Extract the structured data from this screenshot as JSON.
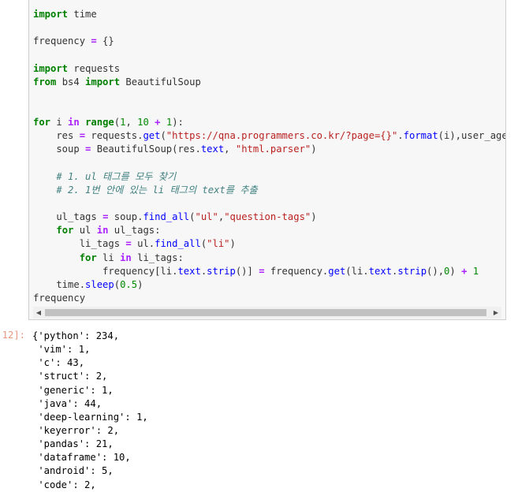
{
  "code_lines": [
    [
      {
        "t": "import",
        "c": "kw"
      },
      {
        "t": " time",
        "c": "plain"
      }
    ],
    [],
    [
      {
        "t": "frequency ",
        "c": "plain"
      },
      {
        "t": "=",
        "c": "op"
      },
      {
        "t": " {}",
        "c": "plain"
      }
    ],
    [],
    [
      {
        "t": "import",
        "c": "kw"
      },
      {
        "t": " requests",
        "c": "plain"
      }
    ],
    [
      {
        "t": "from",
        "c": "kw"
      },
      {
        "t": " bs4 ",
        "c": "plain"
      },
      {
        "t": "import",
        "c": "kw"
      },
      {
        "t": " BeautifulSoup",
        "c": "plain"
      }
    ],
    [],
    [],
    [
      {
        "t": "for",
        "c": "kw"
      },
      {
        "t": " i ",
        "c": "plain"
      },
      {
        "t": "in",
        "c": "op"
      },
      {
        "t": " ",
        "c": "plain"
      },
      {
        "t": "range",
        "c": "kw"
      },
      {
        "t": "(",
        "c": "plain"
      },
      {
        "t": "1",
        "c": "num"
      },
      {
        "t": ", ",
        "c": "plain"
      },
      {
        "t": "10",
        "c": "num"
      },
      {
        "t": " ",
        "c": "plain"
      },
      {
        "t": "+",
        "c": "op"
      },
      {
        "t": " ",
        "c": "plain"
      },
      {
        "t": "1",
        "c": "num"
      },
      {
        "t": "):",
        "c": "plain"
      }
    ],
    [
      {
        "t": "    res ",
        "c": "plain"
      },
      {
        "t": "=",
        "c": "op"
      },
      {
        "t": " requests",
        "c": "plain"
      },
      {
        "t": ".",
        "c": "plain"
      },
      {
        "t": "get",
        "c": "fn"
      },
      {
        "t": "(",
        "c": "plain"
      },
      {
        "t": "\"https://qna.programmers.co.kr/?page={}\"",
        "c": "str"
      },
      {
        "t": ".",
        "c": "plain"
      },
      {
        "t": "format",
        "c": "fn"
      },
      {
        "t": "(i),user_agent",
        "c": "plain"
      }
    ],
    [
      {
        "t": "    soup ",
        "c": "plain"
      },
      {
        "t": "=",
        "c": "op"
      },
      {
        "t": " BeautifulSoup(res",
        "c": "plain"
      },
      {
        "t": ".",
        "c": "plain"
      },
      {
        "t": "text",
        "c": "fn"
      },
      {
        "t": ", ",
        "c": "plain"
      },
      {
        "t": "\"html.parser\"",
        "c": "str"
      },
      {
        "t": ")",
        "c": "plain"
      }
    ],
    [],
    [
      {
        "t": "    # 1. ul 태그를 모두 찾기",
        "c": "cm"
      }
    ],
    [
      {
        "t": "    # 2. 1번 안에 있는 li 태그의 text를 추출",
        "c": "cm"
      }
    ],
    [],
    [
      {
        "t": "    ul_tags ",
        "c": "plain"
      },
      {
        "t": "=",
        "c": "op"
      },
      {
        "t": " soup",
        "c": "plain"
      },
      {
        "t": ".",
        "c": "plain"
      },
      {
        "t": "find_all",
        "c": "fn"
      },
      {
        "t": "(",
        "c": "plain"
      },
      {
        "t": "\"ul\"",
        "c": "str"
      },
      {
        "t": ",",
        "c": "plain"
      },
      {
        "t": "\"question-tags\"",
        "c": "str"
      },
      {
        "t": ")",
        "c": "plain"
      }
    ],
    [
      {
        "t": "    ",
        "c": "plain"
      },
      {
        "t": "for",
        "c": "kw"
      },
      {
        "t": " ul ",
        "c": "plain"
      },
      {
        "t": "in",
        "c": "op"
      },
      {
        "t": " ul_tags:",
        "c": "plain"
      }
    ],
    [
      {
        "t": "        li_tags ",
        "c": "plain"
      },
      {
        "t": "=",
        "c": "op"
      },
      {
        "t": " ul",
        "c": "plain"
      },
      {
        "t": ".",
        "c": "plain"
      },
      {
        "t": "find_all",
        "c": "fn"
      },
      {
        "t": "(",
        "c": "plain"
      },
      {
        "t": "\"li\"",
        "c": "str"
      },
      {
        "t": ")",
        "c": "plain"
      }
    ],
    [
      {
        "t": "        ",
        "c": "plain"
      },
      {
        "t": "for",
        "c": "kw"
      },
      {
        "t": " li ",
        "c": "plain"
      },
      {
        "t": "in",
        "c": "op"
      },
      {
        "t": " li_tags:",
        "c": "plain"
      }
    ],
    [
      {
        "t": "            frequency[li",
        "c": "plain"
      },
      {
        "t": ".",
        "c": "plain"
      },
      {
        "t": "text",
        "c": "fn"
      },
      {
        "t": ".",
        "c": "plain"
      },
      {
        "t": "strip",
        "c": "fn"
      },
      {
        "t": "()] ",
        "c": "plain"
      },
      {
        "t": "=",
        "c": "op"
      },
      {
        "t": " frequency",
        "c": "plain"
      },
      {
        "t": ".",
        "c": "plain"
      },
      {
        "t": "get",
        "c": "fn"
      },
      {
        "t": "(li",
        "c": "plain"
      },
      {
        "t": ".",
        "c": "plain"
      },
      {
        "t": "text",
        "c": "fn"
      },
      {
        "t": ".",
        "c": "plain"
      },
      {
        "t": "strip",
        "c": "fn"
      },
      {
        "t": "(),",
        "c": "plain"
      },
      {
        "t": "0",
        "c": "num"
      },
      {
        "t": ") ",
        "c": "plain"
      },
      {
        "t": "+",
        "c": "op"
      },
      {
        "t": " ",
        "c": "plain"
      },
      {
        "t": "1",
        "c": "num"
      }
    ],
    [
      {
        "t": "    time",
        "c": "plain"
      },
      {
        "t": ".",
        "c": "plain"
      },
      {
        "t": "sleep",
        "c": "fn"
      },
      {
        "t": "(",
        "c": "plain"
      },
      {
        "t": "0.5",
        "c": "num"
      },
      {
        "t": ")",
        "c": "plain"
      }
    ],
    [
      {
        "t": "frequency",
        "c": "plain"
      }
    ]
  ],
  "scrollbar": {
    "left_arrow": "◀",
    "right_arrow": "▶"
  },
  "output_prompt": "12]:",
  "output_lines": [
    "{'python': 234,",
    " 'vim': 1,",
    " 'c': 43,",
    " 'struct': 2,",
    " 'generic': 1,",
    " 'java': 44,",
    " 'deep-learning': 1,",
    " 'keyerror': 2,",
    " 'pandas': 21,",
    " 'dataframe': 10,",
    " 'android': 5,",
    " 'code': 2,"
  ]
}
